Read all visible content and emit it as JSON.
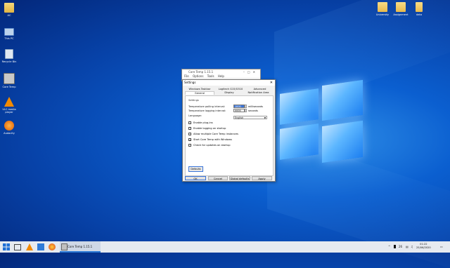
{
  "desktop": {
    "left_icons": [
      {
        "label": "AC",
        "icon": "user-folder-icon"
      },
      {
        "label": "This PC",
        "icon": "computer-icon"
      },
      {
        "label": "Recycle Bin",
        "icon": "recycle-bin-icon"
      },
      {
        "label": "Core Temp",
        "icon": "core-temp-icon"
      },
      {
        "label": "VLC media player",
        "icon": "vlc-icon"
      },
      {
        "label": "Audacity",
        "icon": "audacity-icon"
      }
    ],
    "right_icons": [
      {
        "label": "University",
        "icon": "folder-icon"
      },
      {
        "label": "Assignment",
        "icon": "folder-icon"
      },
      {
        "label": "data",
        "icon": "file-icon"
      }
    ]
  },
  "background_window": {
    "title": "Core Temp 1.15.1",
    "menu": [
      "File",
      "Options",
      "Tools",
      "Help"
    ]
  },
  "settings_dialog": {
    "title": "Settings",
    "tabs_row1": [
      "Windows Taskbar",
      "Logitech G15/G510",
      "Advanced"
    ],
    "tabs_row2": [
      "General",
      "Display",
      "Notification Area"
    ],
    "group_label": "Settings",
    "polling_label": "Temperature polling interval:",
    "polling_value": "1000",
    "polling_unit": "milliseconds",
    "logging_label": "Temperature logging interval:",
    "logging_value": "9999",
    "logging_unit": "seconds",
    "language_label": "Language:",
    "language_value": "English",
    "checkboxes": [
      {
        "label": "Enable plug-ins",
        "checked": false
      },
      {
        "label": "Enable logging on startup",
        "checked": false
      },
      {
        "label": "Allow multiple Core Temp instances",
        "checked": false
      },
      {
        "label": "Start Core Temp with Windows",
        "checked": true
      },
      {
        "label": "Check for updates on startup",
        "checked": false
      }
    ],
    "defaults_button": "Defaults",
    "buttons": {
      "ok": "OK",
      "cancel": "Cancel",
      "global_defaults": "Global defaults",
      "apply": "Apply"
    }
  },
  "taskbar": {
    "active_app": "Core Temp 1.15.1",
    "tray_temp": "26",
    "time": "01:22",
    "date": "25/06/2020"
  }
}
